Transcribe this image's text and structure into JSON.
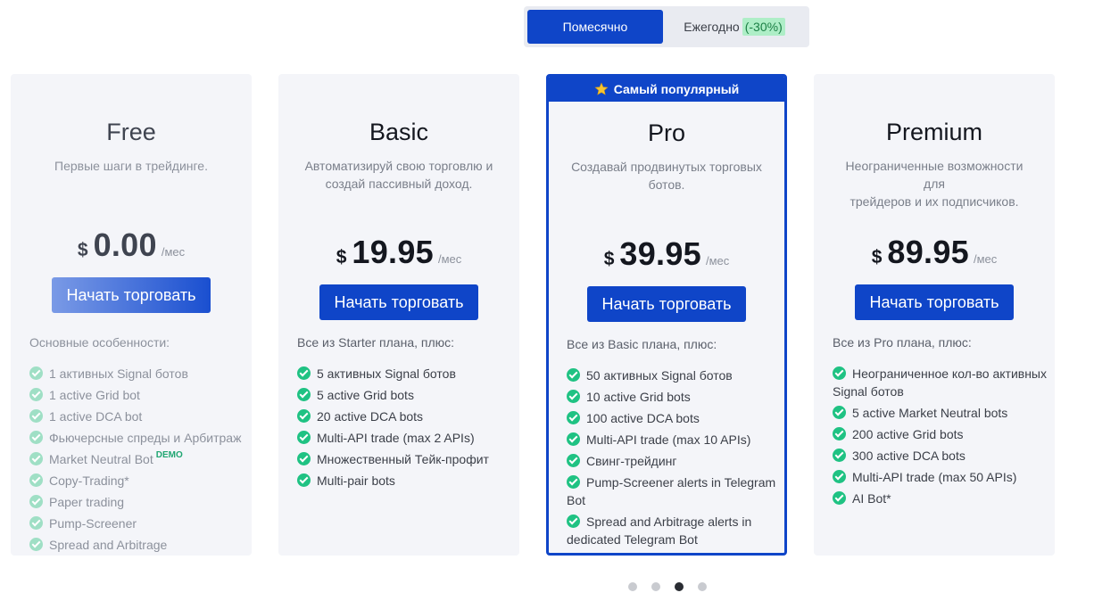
{
  "billing": {
    "monthly": "Помесячно",
    "yearly": "Ежегодно",
    "discount": "(-30%)"
  },
  "colors": {
    "accent": "#0f45c8",
    "check": "#1fc283"
  },
  "plans": [
    {
      "name": "Free",
      "description": "Первые шаги в трейдинге.",
      "currency": "$",
      "price": "0.00",
      "period": "/мес",
      "cta": "Начать торговать",
      "features_title": "Основные особенности:",
      "features": [
        "1 активных Signal ботов",
        "1 active Grid bot",
        "1 active DCA bot",
        "Фьючерсные спреды и Арбитраж",
        "Market Neutral Bot",
        "Copy-Trading*",
        "Paper trading",
        "Pump-Screener",
        "Spread and Arbitrage"
      ],
      "demo_badge": "DEMO"
    },
    {
      "name": "Basic",
      "description_lines": [
        "Автоматизируй свою торговлю и",
        "создай пассивный доход."
      ],
      "currency": "$",
      "price": "19.95",
      "period": "/мес",
      "cta": "Начать торговать",
      "features_title": "Все из Starter плана, плюс:",
      "features": [
        "5 активных Signal ботов",
        "5 active Grid bots",
        "20 active DCA bots",
        "Multi-API trade (max 2 APIs)",
        "Множественный Тейк-профит",
        "Multi-pair bots"
      ]
    },
    {
      "name": "Pro",
      "badge": "Самый популярный",
      "description_lines": [
        "Создавай продвинутых торговых",
        "ботов."
      ],
      "currency": "$",
      "price": "39.95",
      "period": "/мес",
      "cta": "Начать торговать",
      "features_title": "Все из Basic плана, плюс:",
      "features": [
        "50 активных Signal ботов",
        "10 active Grid bots",
        "100 active DCA bots",
        "Multi-API trade (max 10 APIs)",
        "Свинг-трейдинг"
      ],
      "features_wrapped": [
        [
          "Pump-Screener alerts in Telegram",
          "Bot"
        ],
        [
          "Spread and Arbitrage alerts in",
          "dedicated Telegram Bot"
        ]
      ]
    },
    {
      "name": "Premium",
      "description_lines": [
        "Неограниченные возможности для",
        "трейдеров и их подписчиков."
      ],
      "currency": "$",
      "price": "89.95",
      "period": "/мес",
      "cta": "Начать торговать",
      "features_title": "Все из Pro плана, плюс:",
      "features_wrapped": [
        [
          "Неограниченное кол-во активных",
          "Signal ботов"
        ]
      ],
      "features": [
        "5 active Market Neutral bots",
        "200 active Grid bots",
        "300 active DCA bots",
        "Multi-API trade (max 50 APIs)",
        "AI Bot*"
      ]
    }
  ]
}
